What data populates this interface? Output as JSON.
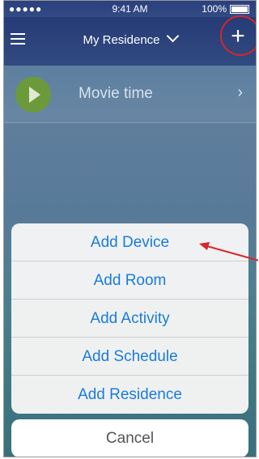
{
  "status_bar": {
    "signal": "●●●●●",
    "time": "9:41 AM",
    "battery": "100%"
  },
  "header": {
    "title": "My Residence"
  },
  "activity": {
    "label": "Movie time"
  },
  "action_sheet": {
    "items": [
      "Add Device",
      "Add Room",
      "Add Activity",
      "Add Schedule",
      "Add Residence"
    ],
    "cancel": "Cancel"
  },
  "colors": {
    "accent": "#1a7bdc",
    "annotation": "#d8262c",
    "play": "#6c9a3b"
  }
}
